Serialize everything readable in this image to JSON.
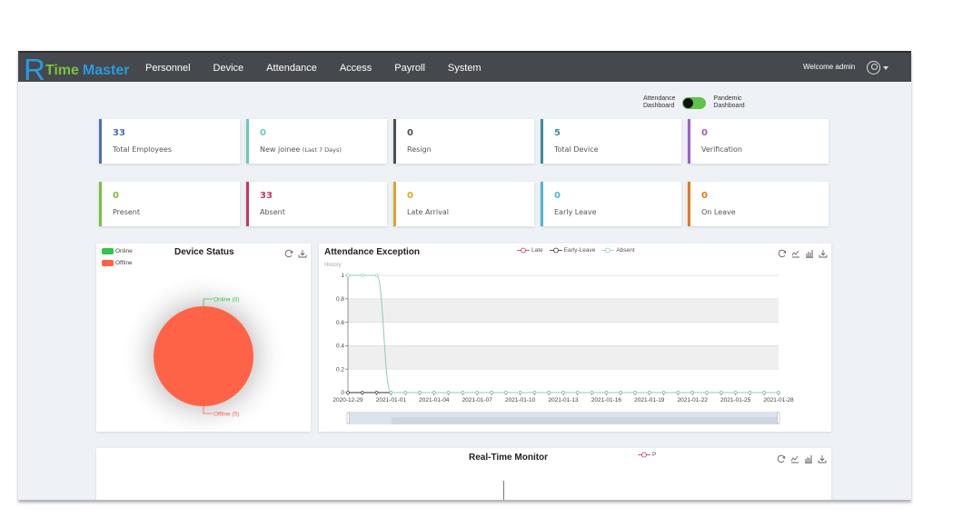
{
  "app": {
    "logo": {
      "r": "R",
      "time": "Time",
      "master": "Master"
    },
    "nav": [
      "Personnel",
      "Device",
      "Attendance",
      "Access",
      "Payroll",
      "System"
    ],
    "welcome": "Welcome admin",
    "user_icon": "user-circle-icon"
  },
  "toggle": {
    "left_label_1": "Attendance",
    "left_label_2": "Dashboard",
    "right_label_1": "Pandemic",
    "right_label_2": "Dashboard",
    "state": "on"
  },
  "stats_row1": [
    {
      "value": "33",
      "label": "Total Employees",
      "suffix": "",
      "color": "#4a6fb5"
    },
    {
      "value": "0",
      "label": "New joinee",
      "suffix": "(Last 7 Days)",
      "color": "#6cc9bd"
    },
    {
      "value": "0",
      "label": "Resign",
      "suffix": "",
      "color": "#4d4f53"
    },
    {
      "value": "5",
      "label": "Total Device",
      "suffix": "",
      "color": "#3d8f9a"
    },
    {
      "value": "0",
      "label": "Verification",
      "suffix": "",
      "color": "#9b5fc8"
    }
  ],
  "stats_row2": [
    {
      "value": "0",
      "label": "Present",
      "suffix": "",
      "color": "#7cbf3e"
    },
    {
      "value": "33",
      "label": "Absent",
      "suffix": "",
      "color": "#c7385a"
    },
    {
      "value": "0",
      "label": "Late Arrival",
      "suffix": "",
      "color": "#d9a82a"
    },
    {
      "value": "0",
      "label": "Early Leave",
      "suffix": "",
      "color": "#4eb8cf"
    },
    {
      "value": "0",
      "label": "On Leave",
      "suffix": "",
      "color": "#e07a1f"
    }
  ],
  "device_status": {
    "title": "Device Status",
    "legend": [
      {
        "label": "Online",
        "color": "#33c24a"
      },
      {
        "label": "Offline",
        "color": "#ff6347"
      }
    ],
    "labels": {
      "online": "Online (0)",
      "offline": "Offline (5)"
    },
    "icons": [
      "refresh-icon",
      "download-icon"
    ]
  },
  "attendance_exception": {
    "title": "Attendance Exception",
    "subtitle": "History",
    "icons": [
      "refresh-icon",
      "line-chart-icon",
      "bar-chart-icon",
      "download-icon"
    ]
  },
  "realtime": {
    "title": "Real-Time Monitor",
    "legend": "P",
    "legend_color": "#c7385a",
    "icons": [
      "refresh-icon",
      "line-chart-icon",
      "bar-chart-icon",
      "download-icon"
    ]
  },
  "chart_data": [
    {
      "type": "pie",
      "title": "Device Status",
      "categories": [
        "Online",
        "Offline"
      ],
      "values": [
        0,
        5
      ],
      "colors": [
        "#33c24a",
        "#ff6347"
      ],
      "legend": "top-left"
    },
    {
      "type": "line",
      "title": "Attendance Exception",
      "subtitle": "History",
      "x": [
        "2020-12-29",
        "2020-12-30",
        "2020-12-31",
        "2021-01-01",
        "2021-01-02",
        "2021-01-03",
        "2021-01-04",
        "2021-01-05",
        "2021-01-06",
        "2021-01-07",
        "2021-01-08",
        "2021-01-09",
        "2021-01-10",
        "2021-01-11",
        "2021-01-12",
        "2021-01-13",
        "2021-01-14",
        "2021-01-15",
        "2021-01-16",
        "2021-01-17",
        "2021-01-18",
        "2021-01-19",
        "2021-01-20",
        "2021-01-21",
        "2021-01-22",
        "2021-01-23",
        "2021-01-24",
        "2021-01-25",
        "2021-01-26",
        "2021-01-27",
        "2021-01-28"
      ],
      "x_tick_labels": [
        "2020-12-29",
        "2021-01-01",
        "2021-01-04",
        "2021-01-07",
        "2021-01-10",
        "2021-01-13",
        "2021-01-16",
        "2021-01-19",
        "2021-01-22",
        "2021-01-25",
        "2021-01-28"
      ],
      "y_ticks": [
        "0",
        "0.2",
        "0.4",
        "0.6",
        "0.8",
        "1"
      ],
      "ylim": [
        0,
        1
      ],
      "series": [
        {
          "name": "Late",
          "color": "#c7385a",
          "values": [
            0,
            0,
            0,
            0,
            0,
            0,
            0,
            0,
            0,
            0,
            0,
            0,
            0,
            0,
            0,
            0,
            0,
            0,
            0,
            0,
            0,
            0,
            0,
            0,
            0,
            0,
            0,
            0,
            0,
            0,
            0
          ]
        },
        {
          "name": "Early-Leave",
          "color": "#333333",
          "values": [
            0,
            0,
            0,
            0,
            0,
            0,
            0,
            0,
            0,
            0,
            0,
            0,
            0,
            0,
            0,
            0,
            0,
            0,
            0,
            0,
            0,
            0,
            0,
            0,
            0,
            0,
            0,
            0,
            0,
            0,
            0
          ]
        },
        {
          "name": "Absent",
          "color": "#8fc9c0",
          "values": [
            1,
            1,
            1,
            0,
            0,
            0,
            0,
            0,
            0,
            0,
            0,
            0,
            0,
            0,
            0,
            0,
            0,
            0,
            0,
            0,
            0,
            0,
            0,
            0,
            0,
            0,
            0,
            0,
            0,
            0,
            0
          ]
        }
      ],
      "legend": "top-center",
      "grid": true,
      "data_zoom": [
        0,
        1
      ]
    }
  ]
}
